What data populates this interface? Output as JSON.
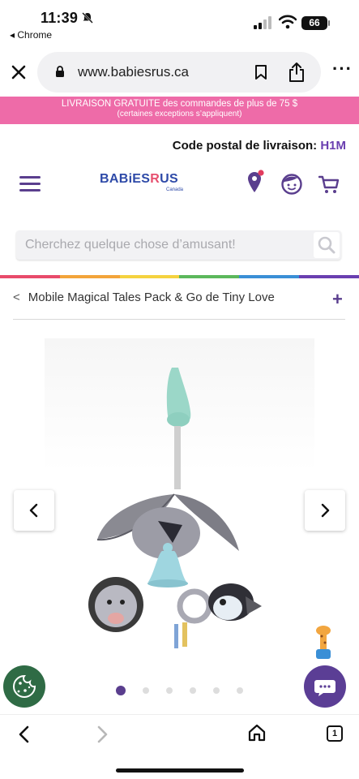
{
  "status_bar": {
    "time": "11:39",
    "back_app": "◂ Chrome",
    "battery": "66"
  },
  "browser": {
    "url": "www.babiesrus.ca"
  },
  "promo": {
    "line1": "LIVRAISON GRATUITE des commandes de plus de 75 $",
    "line2": "(certaines exceptions s’appliquent)"
  },
  "header": {
    "postal_label": "Code postal de livraison:",
    "postal_code": "H1M",
    "logo_text_a": "BABiES",
    "logo_text_r": "R",
    "logo_text_b": "US",
    "logo_sub": "Canada"
  },
  "search": {
    "placeholder": "Cherchez quelque chose d’amusant!"
  },
  "breadcrumb": {
    "chevron": "<",
    "title": "Mobile Magical Tales Pack & Go de Tiny Love",
    "expand": "+"
  },
  "carousel": {
    "total_dots": 6,
    "active_index": 0
  },
  "colors": {
    "promo_pink": "#ee6ba8",
    "brand_purple": "#5a3e8e",
    "rainbow": [
      "#e84b6b",
      "#f3a43a",
      "#f5d23f",
      "#5cb85c",
      "#3a8fd6",
      "#6a3fb0"
    ]
  },
  "icons": [
    "close-icon",
    "lock-icon",
    "bookmark-icon",
    "share-icon",
    "more-icon",
    "menu-icon",
    "location-pin-icon",
    "account-icon",
    "cart-icon",
    "search-icon",
    "chevron-left-icon",
    "chevron-right-icon",
    "cookie-icon",
    "chat-icon",
    "home-icon",
    "tabs-icon"
  ]
}
